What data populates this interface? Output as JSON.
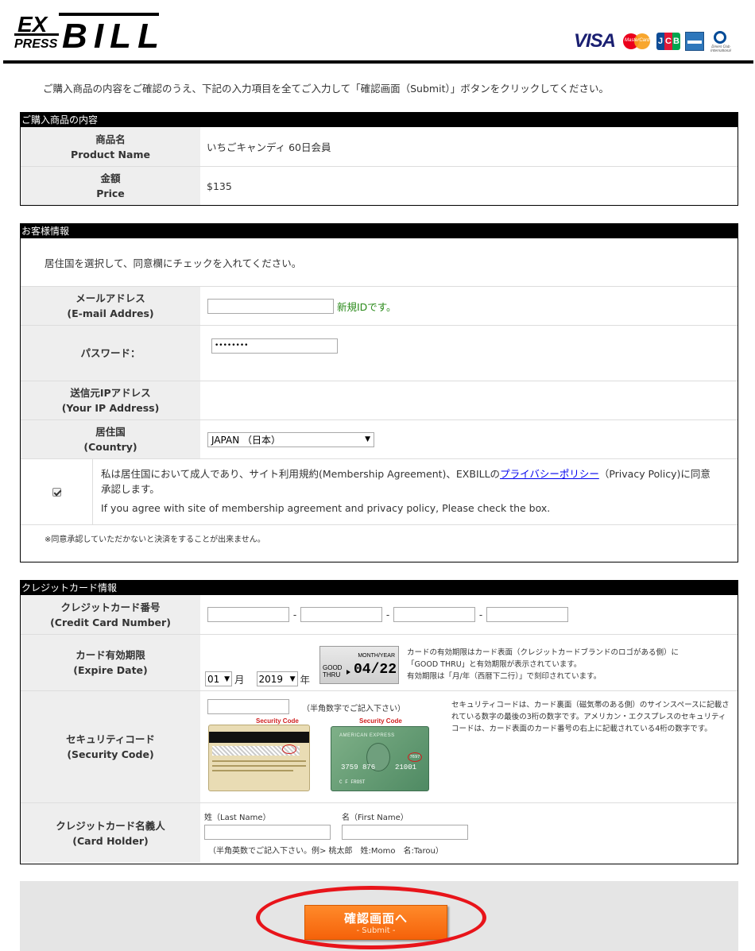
{
  "header": {
    "logo_text": "EXPRESS BILL",
    "logo_ex": "EX",
    "logo_press": "PRESS",
    "logo_bill": "BILL",
    "card_brands": [
      "VISA",
      "MasterCard",
      "JCB",
      "American Express",
      "Diners Club International"
    ],
    "visa_label": "VISA",
    "mc_label": "MasterCard",
    "jcb_letters": [
      "J",
      "C",
      "B"
    ],
    "diners_label": "Diners Club International",
    "colors": {
      "visa": "#1a1f71",
      "mc_red": "#eb001b",
      "mc_yellow": "#f79e1b",
      "jcb": [
        "#0e4c96",
        "#e21836",
        "#00a64f"
      ],
      "amex": "#2e77bb"
    }
  },
  "intro": "ご購入商品の内容をご確認のうえ、下記の入力項目を全てご入力して「確認画面（Submit）」ボタンをクリックしてください。",
  "product": {
    "title": "ご購入商品の内容",
    "name_label_jp": "商品名",
    "name_label_en": "Product Name",
    "name_value": "いちごキャンディ 60日会員",
    "price_label_jp": "金額",
    "price_label_en": "Price",
    "price_value": "$135"
  },
  "customer": {
    "title": "お客様情報",
    "instruction": "居住国を選択して、同意欄にチェックを入れてください。",
    "email_label_jp": "メールアドレス",
    "email_label_en": "(E-mail Addres)",
    "email_value": "",
    "email_note": "新規IDです。",
    "password_label": "パスワード：",
    "password_value": "••••••••",
    "ip_label_jp": "送信元IPアドレス",
    "ip_label_en": "(Your IP Address)",
    "country_label_jp": "居住国",
    "country_label_en": "(Country)",
    "country_value": "JAPAN （日本）",
    "agree_checked": true,
    "agree_text_1": "私は居住国において成人であり、サイト利用規約(Membership Agreement)、EXBILLの",
    "agree_link": "プライバシーポリシー",
    "agree_text_2": "（Privacy Policy)に同意",
    "agree_text_3": "承認します。",
    "agree_text_en": "If you agree with site of membership agreement and privacy policy, Please check the box.",
    "agree_note": "※同意承認していただかないと決済をすることが出来ません。"
  },
  "credit": {
    "title": "クレジットカード情報",
    "number_label_jp": "クレジットカード番号",
    "number_label_en": "(Credit Card Number)",
    "number_dash": "-",
    "expire_label_jp": "カード有効期限",
    "expire_label_en": "(Expire Date)",
    "month_value": "01",
    "month_unit": "月",
    "year_value": "2019",
    "year_unit": "年",
    "sample_month_year": "MONTH/YEAR",
    "sample_good_thru": "GOOD THRU",
    "sample_date": "04/22",
    "expire_note_1": "カードの有効期限はカード表面（クレジットカードブランドのロゴがある側）に",
    "expire_note_2": "「GOOD THRU」と有効期限が表示されています。",
    "expire_note_3": "有効期限は「月/年（西暦下二行）」で刻印されています。",
    "security_label_jp": "セキュリティコード",
    "security_label_en": "(Security Code)",
    "security_hint": "（半角数字でご記入下さい）",
    "security_tag": "Security Code",
    "amex_label": "AMERICAN EXPRESS",
    "amex_digits": "3759 876",
    "amex_number_end": "21001",
    "amex_code": "7697",
    "amex_holder": "C F FROST",
    "security_note": "セキュリティコードは、カード裏面（磁気帯のある側）のサインスペースに記載されている数字の最後の3桁の数字です。アメリカン・エクスプレスのセキュリティコードは、カード表面のカード番号の右上に記載されている4桁の数字です。",
    "holder_label_jp": "クレジットカード名義人",
    "holder_label_en": "(Card Holder)",
    "last_name_label": "姓（Last Name）",
    "first_name_label": "名（First Name）",
    "holder_hint": "（半角英数でご記入下さい。例> 桃太郎　姓:Momo　名:Tarou）"
  },
  "submit": {
    "label": "確認画面へ",
    "sub": "- Submit -"
  }
}
